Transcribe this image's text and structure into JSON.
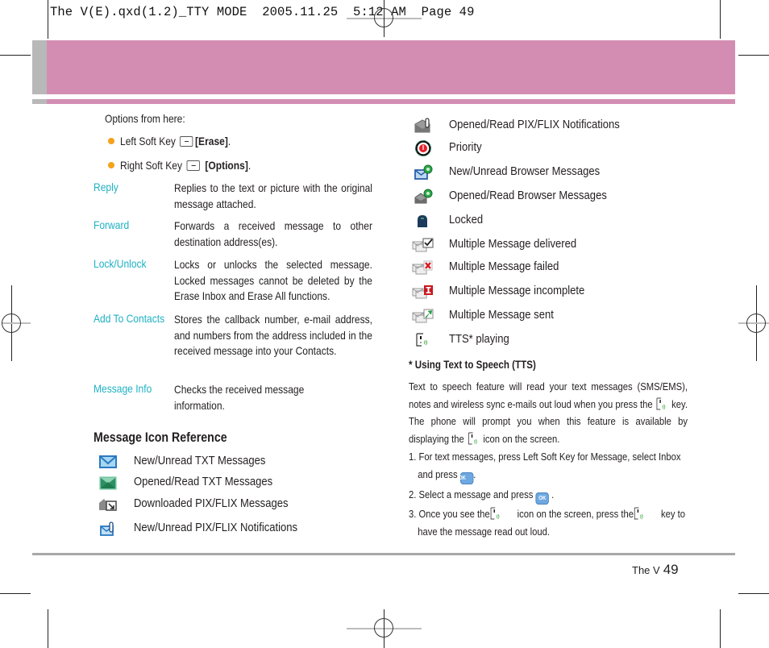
{
  "slug": "The V(E).qxd(1.2)_TTY MODE  2005.11.25  5:12 AM  Page 49",
  "intro": {
    "options_label": "Options from here:",
    "bullets": [
      {
        "text": "Left Soft Key",
        "key_icon": "left-soft-key-icon",
        "action": "[Erase]",
        "suffix": "."
      },
      {
        "text": "Right Soft Key",
        "key_icon": "right-soft-key-icon",
        "action": "[Options]",
        "suffix": "."
      }
    ],
    "bullet_color": "#f5a21c"
  },
  "definitions": [
    {
      "term": "Reply",
      "desc": "Replies to the text or picture with the original message attached."
    },
    {
      "term": "Forward",
      "desc": "Forwards a received message to other destination address(es)."
    },
    {
      "term": "Lock/Unlock",
      "desc": "Locks or unlocks the selected message. Locked messages cannot be deleted by the Erase Inbox and Erase All functions."
    },
    {
      "term": "Add To Contacts",
      "desc": "Stores the callback number, e-mail address, and numbers from the address included in the received message into your Contacts."
    },
    {
      "term": "Message Info",
      "desc": "Checks the received message information."
    }
  ],
  "term_color": "#1fb1c4",
  "icon_reference": {
    "heading": "Message Icon Reference",
    "left_items": [
      {
        "icon": "new-unread-txt-icon",
        "label": "New/Unread TXT Messages"
      },
      {
        "icon": "opened-read-txt-icon",
        "label": "Opened/Read TXT Messages"
      },
      {
        "icon": "downloaded-pix-flix-icon",
        "label": "Downloaded PIX/FLIX Messages"
      },
      {
        "icon": "new-unread-pix-flix-notification-icon",
        "label": "New/Unread PIX/FLIX Notifications"
      }
    ],
    "right_items": [
      {
        "icon": "opened-read-pix-flix-notification-icon",
        "label": "Opened/Read PIX/FLIX Notifications"
      },
      {
        "icon": "priority-icon",
        "label": "Priority"
      },
      {
        "icon": "new-unread-browser-icon",
        "label": "New/Unread Browser Messages"
      },
      {
        "icon": "opened-read-browser-icon",
        "label": "Opened/Read Browser Messages"
      },
      {
        "icon": "locked-icon",
        "label": "Locked"
      },
      {
        "icon": "multiple-message-delivered-icon",
        "label": "Multiple Message delivered"
      },
      {
        "icon": "multiple-message-failed-icon",
        "label": "Multiple Message failed"
      },
      {
        "icon": "multiple-message-incomplete-icon",
        "label": "Multiple Message incomplete"
      },
      {
        "icon": "multiple-message-sent-icon",
        "label": "Multiple Message sent"
      },
      {
        "icon": "tts-playing-icon",
        "label": "TTS* playing"
      }
    ]
  },
  "tts": {
    "heading": "* Using Text to Speech (TTS)",
    "para_part1": "Text to speech feature will read your text messages (SMS/EMS), notes and wireless sync e-mails out loud when you press the",
    "para_part2": "key. The phone will prompt you when this feature is available by displaying the",
    "para_part3": "icon on the screen.",
    "steps": [
      {
        "num": "1.",
        "part1": "For text messages, press Left Soft Key for Message, select Inbox and press",
        "part2": "."
      },
      {
        "num": "2.",
        "part1": "Select a message and press",
        "part2": "."
      },
      {
        "num": "3.",
        "part1": "Once you see the",
        "part2": "icon on the screen, press the",
        "part3": "key to have the message read out loud."
      }
    ],
    "ok_label": "OK"
  },
  "footer": {
    "book": "The V",
    "page": "49"
  },
  "colors": {
    "header_band": "#d38db2",
    "header_side": "#b8b8b8"
  }
}
